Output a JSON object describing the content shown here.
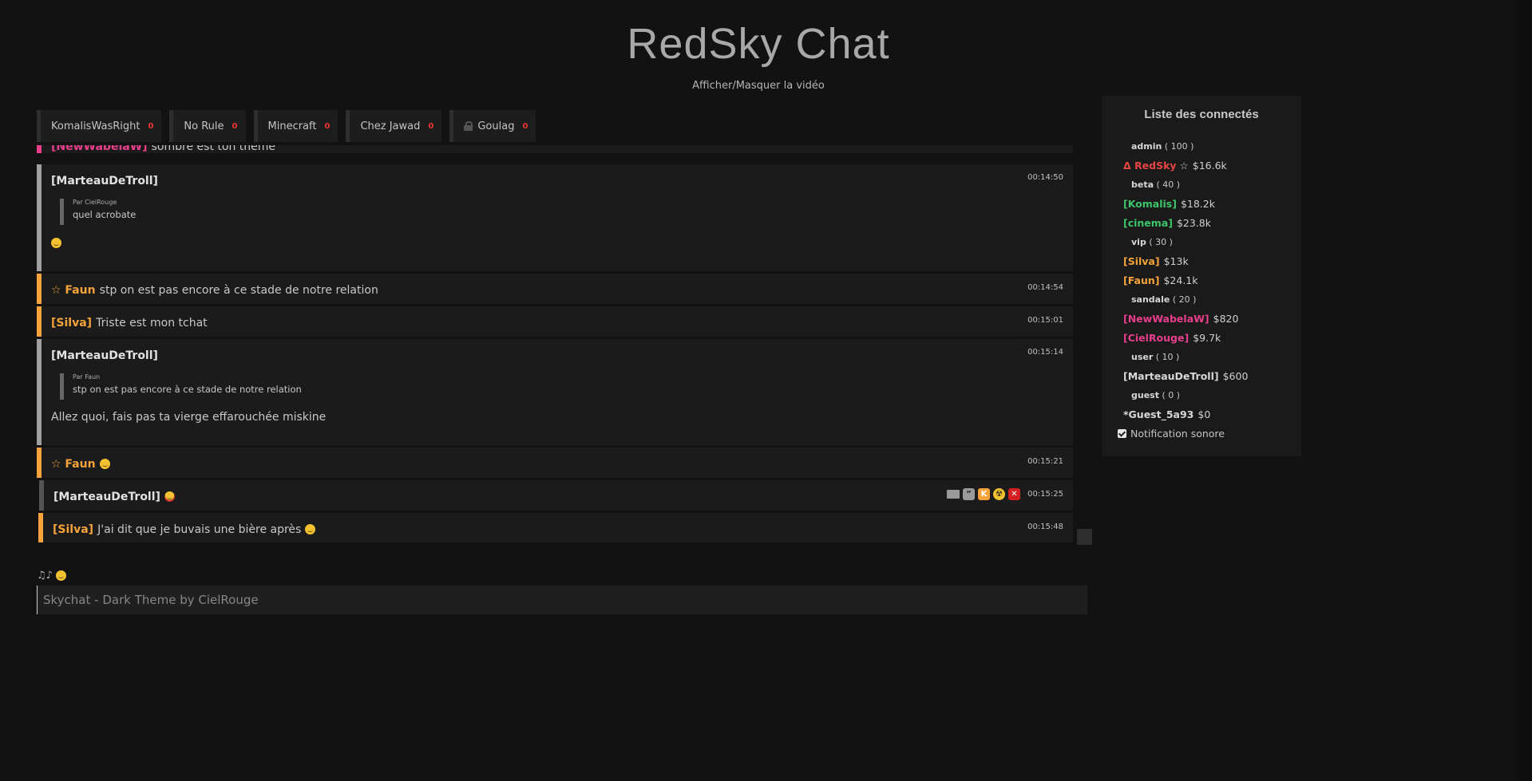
{
  "header": {
    "title": "RedSky Chat",
    "video_toggle": "Afficher/Masquer la vidéo"
  },
  "tabs": [
    {
      "label": "KomalisWasRight",
      "count": "0",
      "locked": false
    },
    {
      "label": "No Rule",
      "count": "0",
      "locked": false
    },
    {
      "label": "Minecraft",
      "count": "0",
      "locked": false
    },
    {
      "label": "Chez Jawad",
      "count": "0",
      "locked": false
    },
    {
      "label": "Goulag",
      "count": "0",
      "locked": true
    }
  ],
  "messages": [
    {
      "user": "[NewWabelaW]",
      "text": "sombre est ton thème",
      "time": ""
    },
    {
      "user": "[MarteauDeTroll]",
      "time": "00:14:50",
      "quote_by": "Par CielRouge",
      "quote_text": "quel acrobate",
      "text": ""
    },
    {
      "user": "☆ Faun",
      "text": "stp on est pas encore à ce stade de notre relation",
      "time": "00:14:54"
    },
    {
      "user": "[Silva]",
      "text": "Triste est mon tchat",
      "time": "00:15:01"
    },
    {
      "user": "[MarteauDeTroll]",
      "time": "00:15:14",
      "quote_by": "Par Faun",
      "quote_text": "stp on est pas encore à ce stade de notre relation",
      "text": "Allez quoi, fais pas ta vierge effarouchée miskine"
    },
    {
      "user": "☆ Faun",
      "text": "",
      "time": "00:15:21"
    },
    {
      "user": "[MarteauDeTroll]",
      "text": "",
      "time": "00:15:25"
    },
    {
      "user": "[Silva]",
      "text": "J'ai dit que je buvais une bière après",
      "time": "00:15:48"
    }
  ],
  "message_actions": [
    {
      "icon": "mail-icon",
      "label": ""
    },
    {
      "icon": "quote-icon",
      "label": "”"
    },
    {
      "icon": "kick-icon",
      "label": "K"
    },
    {
      "icon": "nuke-icon",
      "label": "☢"
    },
    {
      "icon": "delete-icon",
      "label": "✕"
    }
  ],
  "player": {
    "now_playing": "♫♪"
  },
  "input": {
    "placeholder": "Skychat - Dark Theme by CielRouge"
  },
  "sidebar": {
    "title": "Liste des connectés",
    "ranks": {
      "admin": {
        "name": "admin",
        "level": "( 100 )"
      },
      "beta": {
        "name": "beta",
        "level": "( 40 )"
      },
      "vip": {
        "name": "vip",
        "level": "( 30 )"
      },
      "sandale": {
        "name": "sandale",
        "level": "( 20 )"
      },
      "user": {
        "name": "user",
        "level": "( 10 )"
      },
      "guest": {
        "name": "guest",
        "level": "( 0 )"
      }
    },
    "users": {
      "redsky": {
        "name": "Δ RedSky",
        "star": "☆",
        "money": "$16.6k"
      },
      "komalis": {
        "name": "[Komalis]",
        "money": "$18.2k"
      },
      "cinema": {
        "name": "[cinema]",
        "money": "$23.8k"
      },
      "silva": {
        "name": "[Silva]",
        "money": "$13k"
      },
      "faun": {
        "name": "[Faun]",
        "money": "$24.1k"
      },
      "newwabelaw": {
        "name": "[NewWabelaW]",
        "money": "$820"
      },
      "cielrouge": {
        "name": "[CielRouge]",
        "money": "$9.7k"
      },
      "marteau": {
        "name": "[MarteauDeTroll]",
        "money": "$600"
      },
      "guest": {
        "name": "*Guest_5a93",
        "money": "$0"
      }
    },
    "notification_label": "Notification sonore",
    "notification_checked": true
  },
  "colors": {
    "background": "#121212",
    "accent_orange": "#f5a33a",
    "accent_pink": "#e83e8c",
    "accent_green": "#3cc56a",
    "accent_red": "#e84545"
  }
}
